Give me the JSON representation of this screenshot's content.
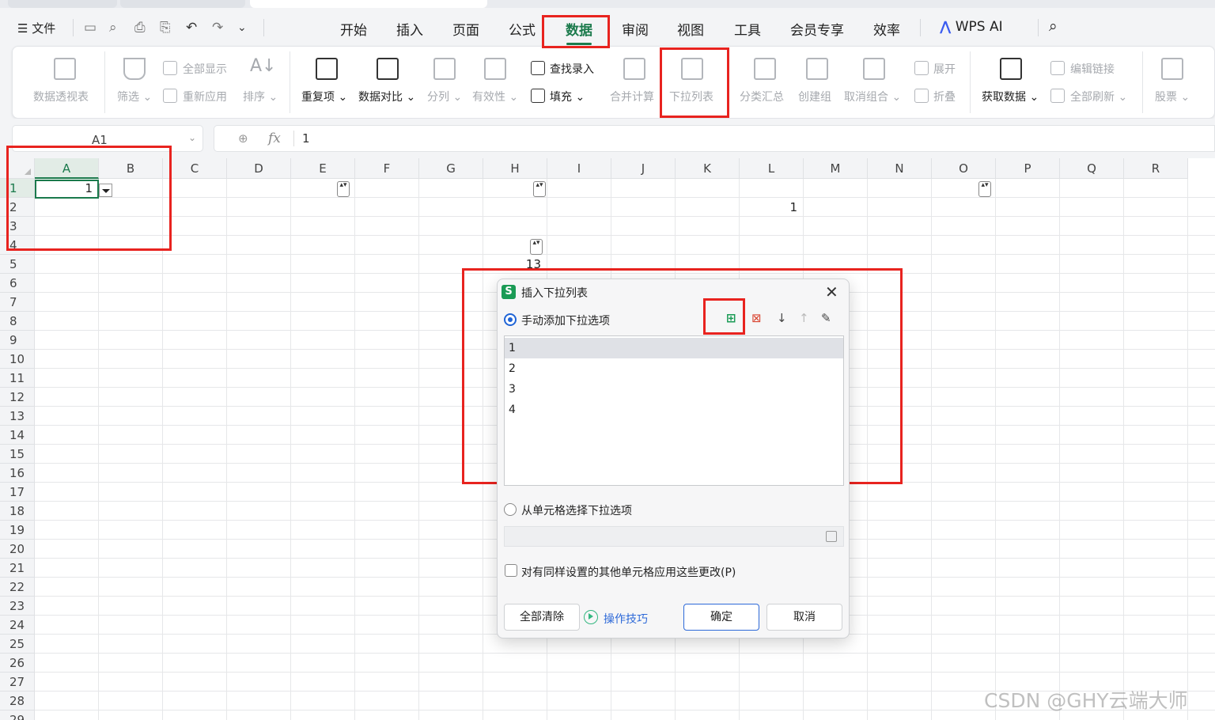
{
  "menubar": {
    "file_label": "文件",
    "tabs": [
      "开始",
      "插入",
      "页面",
      "公式",
      "数据",
      "审阅",
      "视图",
      "工具",
      "会员专享",
      "效率"
    ],
    "active_tab": "数据",
    "wps_ai": "WPS AI"
  },
  "ribbon": {
    "pivot": "数据透视表",
    "filter": "筛选",
    "show_all": "全部显示",
    "reapply": "重新应用",
    "sort": "排序",
    "duplicates": "重复项",
    "compare": "数据对比",
    "split": "分列",
    "validity": "有效性",
    "find_entry": "查找录入",
    "fill": "填充",
    "consolidate": "合并计算",
    "dropdown_list": "下拉列表",
    "subtotal": "分类汇总",
    "create_group": "创建组",
    "ungroup": "取消组合",
    "expand": "展开",
    "collapse": "折叠",
    "get_data": "获取数据",
    "edit_links": "编辑链接",
    "refresh_all": "全部刷新",
    "stocks": "股票"
  },
  "formula_bar": {
    "name_box": "A1",
    "fx": "fx",
    "value": "1"
  },
  "sheet": {
    "columns": [
      "A",
      "B",
      "C",
      "D",
      "E",
      "F",
      "G",
      "H",
      "I",
      "J",
      "K",
      "L",
      "M",
      "N",
      "O",
      "P",
      "Q",
      "R"
    ],
    "rows": [
      "1",
      "2",
      "3",
      "4",
      "5",
      "6",
      "7",
      "8",
      "9",
      "10",
      "11",
      "12",
      "13",
      "14",
      "15",
      "16",
      "17",
      "18",
      "19",
      "20",
      "21",
      "22",
      "23",
      "24",
      "25",
      "26",
      "27",
      "28",
      "29"
    ],
    "cells": {
      "A1": "1",
      "L2": "1",
      "H5": "13"
    }
  },
  "dialog": {
    "title": "插入下拉列表",
    "manual_option": "手动添加下拉选项",
    "items": [
      "1",
      "2",
      "3",
      "4"
    ],
    "from_cells_option": "从单元格选择下拉选项",
    "apply_all": "对有同样设置的其他单元格应用这些更改(P)",
    "clear_all": "全部清除",
    "tips": "操作技巧",
    "ok": "确定",
    "cancel": "取消"
  },
  "watermark": "CSDN @GHY云端大师",
  "colors": {
    "accent_green": "#1b7a4c",
    "annotation_red": "#e8231f",
    "primary_blue": "#2d69d8"
  }
}
